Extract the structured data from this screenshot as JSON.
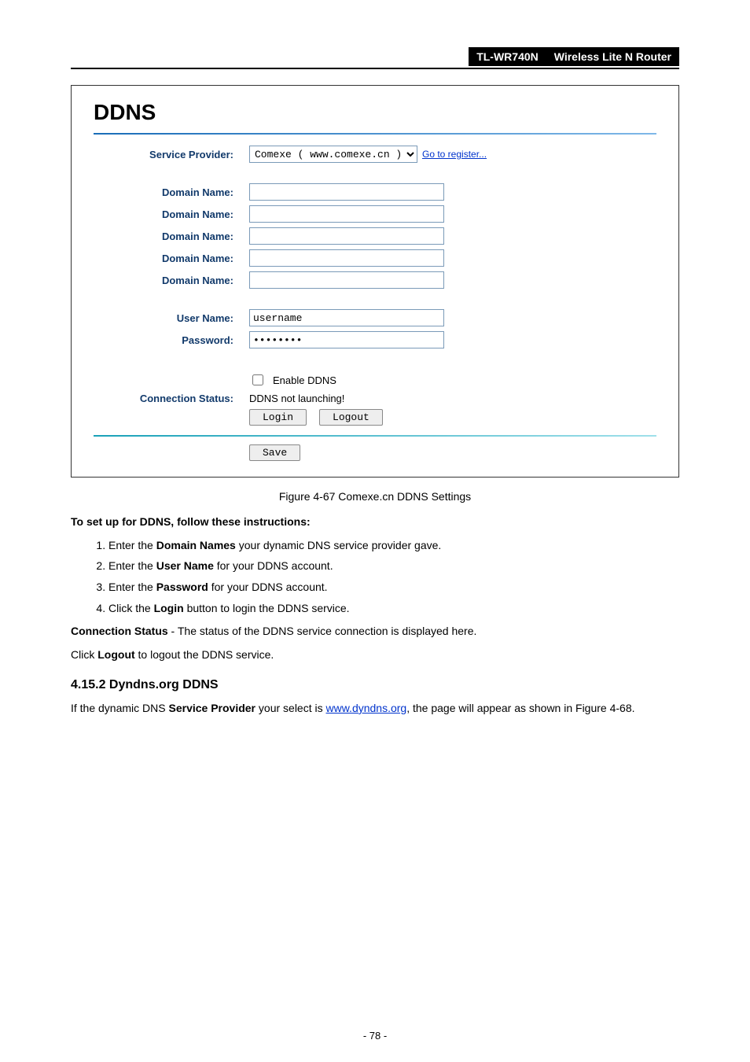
{
  "header": {
    "model": "TL-WR740N",
    "product": "Wireless Lite N Router"
  },
  "panel": {
    "title": "DDNS",
    "serviceProviderLabel": "Service Provider:",
    "serviceProviderValue": "Comexe ( www.comexe.cn )",
    "goToRegister": "Go to register...",
    "domainLabels": [
      "Domain Name:",
      "Domain Name:",
      "Domain Name:",
      "Domain Name:",
      "Domain Name:"
    ],
    "domainValues": [
      "",
      "",
      "",
      "",
      ""
    ],
    "userNameLabel": "User Name:",
    "userNameValue": "username",
    "passwordLabel": "Password:",
    "passwordValue": "••••••••",
    "enableDdnsLabel": "Enable DDNS",
    "connectionStatusLabel": "Connection Status:",
    "connectionStatusValue": "DDNS not launching!",
    "loginBtn": "Login",
    "logoutBtn": "Logout",
    "saveBtn": "Save"
  },
  "caption": "Figure 4-67 Comexe.cn DDNS Settings",
  "body": {
    "instrHead": "To set up for DDNS, follow these instructions:",
    "steps": [
      {
        "pre": "Enter the ",
        "bold": "Domain Names",
        "post": " your dynamic DNS service provider gave."
      },
      {
        "pre": "Enter the ",
        "bold": "User Name",
        "post": " for your DDNS account."
      },
      {
        "pre": "Enter the ",
        "bold": "Password",
        "post": " for your DDNS account."
      },
      {
        "pre": "Click the ",
        "bold": "Login",
        "post": " button to login the DDNS service."
      }
    ],
    "connStatus": {
      "boldA": "Connection Status",
      "rest": " - The status of the DDNS service connection is displayed here."
    },
    "logoutLine": {
      "pre": "Click ",
      "bold": "Logout",
      "post": " to logout the DDNS service."
    },
    "subHeading": "4.15.2   Dyndns.org DDNS",
    "para2": {
      "pre": "If the dynamic DNS ",
      "bold": "Service Provider",
      "mid": " your select is ",
      "link": "www.dyndns.org",
      "post": ", the page will appear as shown in Figure 4-68."
    }
  },
  "pageNumber": "- 78 -"
}
